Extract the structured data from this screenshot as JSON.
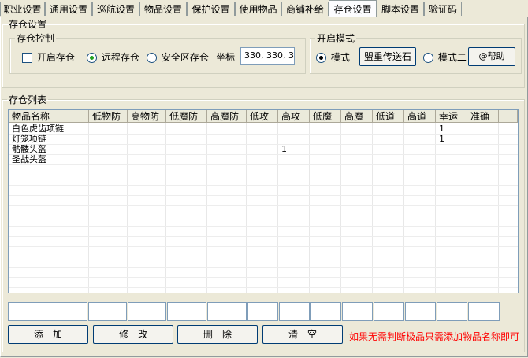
{
  "tabs": [
    {
      "label": "职业设置"
    },
    {
      "label": "通用设置"
    },
    {
      "label": "巡航设置"
    },
    {
      "label": "物品设置"
    },
    {
      "label": "保护设置"
    },
    {
      "label": "使用物品"
    },
    {
      "label": "商铺补给"
    },
    {
      "label": "存仓设置",
      "active": true
    },
    {
      "label": "脚本设置"
    },
    {
      "label": "验证码"
    }
  ],
  "storage": {
    "section_title": "存仓设置",
    "control_group": "存仓控制",
    "enable_label": "开启存仓",
    "enable_checked": false,
    "remote_label": "远程存仓",
    "remote_selected": true,
    "safezone_label": "安全区存仓",
    "coord_label": "坐标",
    "coord_value": "330, 330, 3",
    "mode_group": "开启模式",
    "mode1_label": "模式一",
    "mode1_selected": true,
    "mode1_button": "盟重传送石",
    "mode2_label": "模式二",
    "help_button": "@帮助"
  },
  "list": {
    "title": "存仓列表",
    "columns": [
      "物品名称",
      "低物防",
      "高物防",
      "低魔防",
      "高魔防",
      "低攻",
      "高攻",
      "低魔",
      "高魔",
      "低道",
      "高道",
      "幸运",
      "准确"
    ],
    "rows": [
      [
        "白色虎齿项链",
        "",
        "",
        "",
        "",
        "",
        "",
        "",
        "",
        "",
        "",
        "1",
        ""
      ],
      [
        "灯笼项链",
        "",
        "",
        "",
        "",
        "",
        "",
        "",
        "",
        "",
        "",
        "1",
        ""
      ],
      [
        "骷髅头盔",
        "",
        "",
        "",
        "",
        "",
        "1",
        "",
        "",
        "",
        "",
        "",
        ""
      ],
      [
        "圣战头盔",
        "",
        "",
        "",
        "",
        "",
        "",
        "",
        "",
        "",
        "",
        "",
        ""
      ]
    ]
  },
  "actions": {
    "add": "添　加",
    "modify": "修　改",
    "delete": "删　除",
    "clear": "清　空",
    "hint": "如果无需判断极品只需添加物品名称即可"
  }
}
